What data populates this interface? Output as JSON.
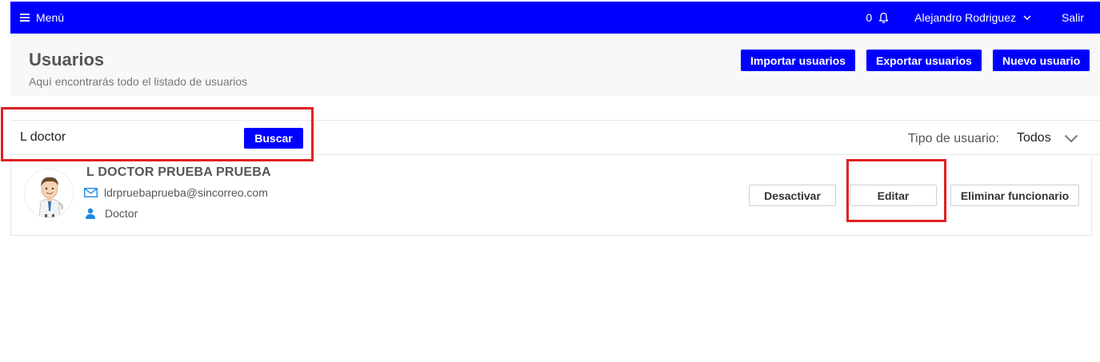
{
  "topbar": {
    "menu_label": "Menú",
    "notifications_count": "0",
    "user_name": "Alejandro Rodriguez",
    "logout_label": "Salir",
    "bg_color": "#0000ff"
  },
  "header": {
    "title": "Usuarios",
    "subtitle": "Aquí encontrarás todo el listado de usuarios",
    "import_label": "Importar usuarios",
    "export_label": "Exportar usuarios",
    "new_label": "Nuevo usuario"
  },
  "filter": {
    "search_value": "L doctor",
    "search_button": "Buscar",
    "type_label": "Tipo de usuario:",
    "type_value": "Todos"
  },
  "users": [
    {
      "name": "L DOCTOR PRUEBA PRUEBA",
      "email": "ldrpruebaprueba@sincorreo.com",
      "role": "Doctor",
      "deactivate_label": "Desactivar",
      "edit_label": "Editar",
      "delete_label": "Eliminar funcionario"
    }
  ],
  "icons": {
    "menu": "hamburger-icon",
    "notifications": "bell-icon",
    "user_menu": "chevron-down-icon",
    "email": "envelope-icon",
    "role": "person-icon",
    "type_select": "chevron-down-icon"
  },
  "highlight_color": "#e02020"
}
